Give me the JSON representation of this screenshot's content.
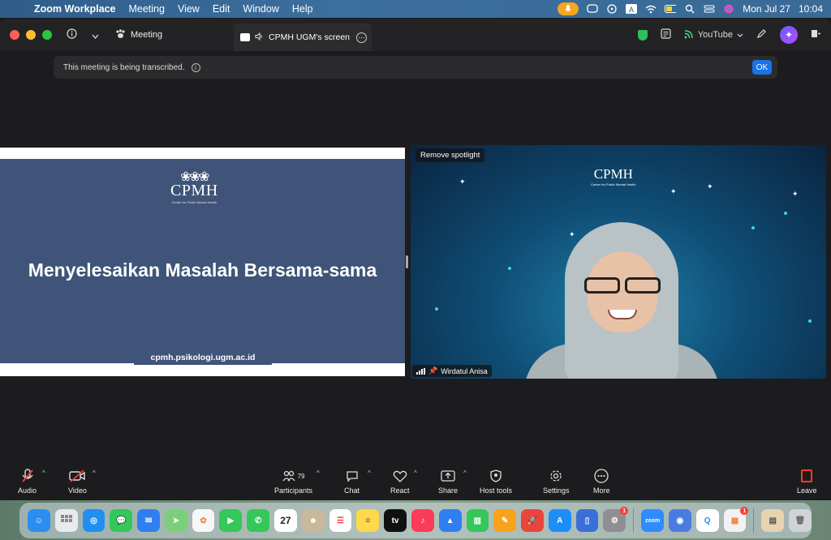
{
  "menubar": {
    "app": "Zoom Workplace",
    "items": [
      "Meeting",
      "View",
      "Edit",
      "Window",
      "Help"
    ],
    "date": "Mon Jul 27",
    "time": "10:04"
  },
  "titlebar": {
    "meeting_label": "Meeting",
    "screen_tab_label": "CPMH UGM's screen",
    "youtube_label": "YouTube"
  },
  "banner": {
    "text": "This meeting is being transcribed.",
    "ok_label": "OK"
  },
  "slide": {
    "logo_text": "CPMH",
    "logo_sub": "Center for Public Mental Health",
    "title": "Menyelesaikan Masalah Bersama-sama",
    "footer_url": "cpmh.psikologi.ugm.ac.id"
  },
  "video": {
    "remove_spotlight": "Remove spotlight",
    "logo_text": "CPMH",
    "logo_sub": "Center for Public Mental Health",
    "participant_name": "Wirdatul Anisa"
  },
  "toolbar": {
    "audio": "Audio",
    "video": "Video",
    "participants": "Participants",
    "participants_count": "79",
    "chat": "Chat",
    "react": "React",
    "share": "Share",
    "host_tools": "Host tools",
    "settings": "Settings",
    "more": "More",
    "leave": "Leave"
  },
  "dock": {
    "calendar_day": "27",
    "settings_badge": "1",
    "office_badge": "1",
    "apps": [
      {
        "name": "finder-icon",
        "color": "#2a8ef0"
      },
      {
        "name": "launchpad-icon",
        "color": "#e0e0e0"
      },
      {
        "name": "safari-icon",
        "color": "#1f8ff0"
      },
      {
        "name": "messages-icon",
        "color": "#34c759"
      },
      {
        "name": "mail-icon",
        "color": "#2f7ff0"
      },
      {
        "name": "maps-icon",
        "color": "#5cc26a"
      },
      {
        "name": "photos-icon",
        "color": "#f3a33b"
      },
      {
        "name": "facetime-icon",
        "color": "#34c759"
      },
      {
        "name": "phone-icon",
        "color": "#34c759"
      }
    ]
  },
  "colors": {
    "slide_blue": "#3f5478",
    "ok_button": "#1a73e8",
    "mute_red": "#ff3b30",
    "menubar_mic": "#f5a623"
  }
}
